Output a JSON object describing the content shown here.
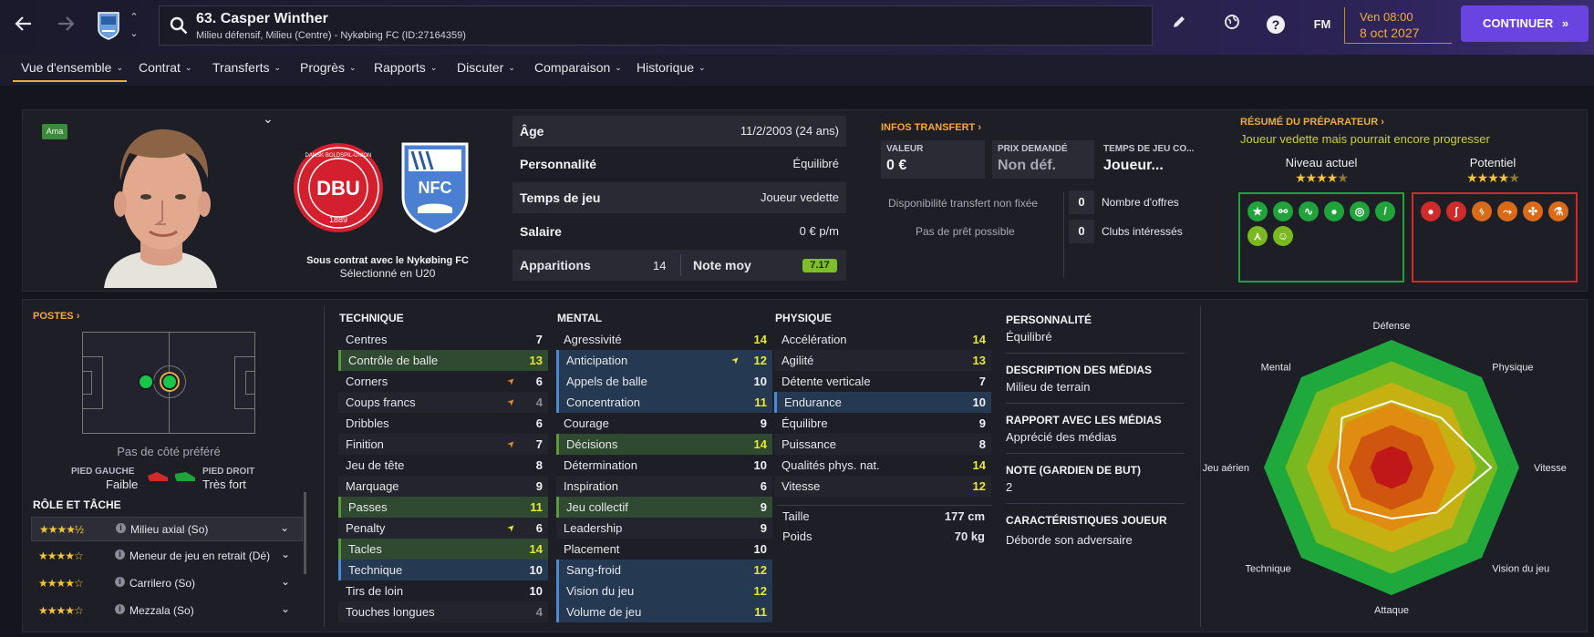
{
  "header": {
    "player_title": "63. Casper Winther",
    "player_subtitle": "Milieu défensif, Milieu (Centre) - Nykøbing FC (ID:27164359)",
    "fm_label": "FM",
    "date_line1": "Ven 08:00",
    "date_line2": "8 oct 2027",
    "continue_label": "CONTINUER",
    "icons": [
      "back-arrow-icon",
      "forward-arrow-icon",
      "club-badge-icon",
      "up-down-chevron-icon",
      "search-icon",
      "pencil-icon",
      "globe-icon",
      "help-icon",
      "continue-chevron-icon"
    ]
  },
  "tabs": [
    {
      "label": "Vue d'ensemble",
      "active": true
    },
    {
      "label": "Contrat"
    },
    {
      "label": "Transferts"
    },
    {
      "label": "Progrès"
    },
    {
      "label": "Rapports"
    },
    {
      "label": "Discuter"
    },
    {
      "label": "Comparaison"
    },
    {
      "label": "Historique"
    }
  ],
  "profile": {
    "ama_badge": "Ama",
    "dbu_text_top": "DANSK BOLDSPIL-UNION",
    "dbu_letters": "DBU",
    "dbu_year": "1889",
    "nfc_letters": "NFC",
    "contract_line": "Sous contrat avec le Nykøbing FC",
    "selection_line": "Sélectionné en U20"
  },
  "info": {
    "rows": [
      {
        "k": "Âge",
        "v": "11/2/2003 (24 ans)"
      },
      {
        "k": "Personnalité",
        "v": "Équilibré"
      },
      {
        "k": "Temps de jeu",
        "v": "Joueur vedette"
      },
      {
        "k": "Salaire",
        "v": "0 € p/m"
      }
    ],
    "appearances_label": "Apparitions",
    "appearances_value": "14",
    "rating_label": "Note moy",
    "rating_value": "7.17"
  },
  "transfer": {
    "title": "INFOS TRANSFERT",
    "value_label": "VALEUR",
    "value": "0 €",
    "asking_label": "PRIX DEMANDÉ",
    "asking_value": "Non déf.",
    "playtime_label": "TEMPS DE JEU CO...",
    "playtime_value": "Joueur...",
    "availability": "Disponibilité transfert non fixée",
    "loan": "Pas de prêt possible",
    "offers_count": "0",
    "offers_label": "Nombre d'offres",
    "clubs_count": "0",
    "clubs_label": "Clubs intéressés"
  },
  "coach_report": {
    "title": "RÉSUMÉ DU PRÉPARATEUR",
    "summary": "Joueur vedette mais pourrait encore progresser",
    "current_label": "Niveau actuel",
    "current_stars": 4.5,
    "potential_label": "Potentiel",
    "potential_stars": 4.5,
    "strengths_icons": [
      "star-icon",
      "boots-icon",
      "wave-icon",
      "brain-icon",
      "target-icon",
      "bandage-icon",
      "run-icon",
      "smile-icon"
    ],
    "weaknesses_icons": [
      "ball-icon",
      "ankle-icon",
      "kick-icon",
      "tackle-icon",
      "lungs-icon",
      "flask-icon"
    ],
    "strength_color": "#1fa33a",
    "weakness_color": "#d12a2a"
  },
  "positions": {
    "title": "POSTES",
    "no_side": "Pas de côté préféré",
    "left_foot_label": "PIED GAUCHE",
    "left_foot_value": "Faible",
    "right_foot_label": "PIED DROIT",
    "right_foot_value": "Très fort",
    "roles_title": "RÔLE ET TÂCHE",
    "roles": [
      {
        "stars": "★★★★½",
        "name": "Milieu axial (So)"
      },
      {
        "stars": "★★★★☆",
        "name": "Meneur de jeu en retrait (Dé)"
      },
      {
        "stars": "★★★★☆",
        "name": "Carrilero (So)"
      },
      {
        "stars": "★★★★☆",
        "name": "Mezzala (So)"
      }
    ]
  },
  "attributes": {
    "technique_title": "TECHNIQUE",
    "mental_title": "MENTAL",
    "physical_title": "PHYSIQUE",
    "technique": [
      {
        "n": "Centres",
        "v": "7"
      },
      {
        "n": "Contrôle de balle",
        "v": "13",
        "hl": "g"
      },
      {
        "n": "Corners",
        "v": "6",
        "t": "o"
      },
      {
        "n": "Coups francs",
        "v": "4",
        "t": "o"
      },
      {
        "n": "Dribbles",
        "v": "6"
      },
      {
        "n": "Finition",
        "v": "7",
        "t": "o"
      },
      {
        "n": "Jeu de tête",
        "v": "8"
      },
      {
        "n": "Marquage",
        "v": "9"
      },
      {
        "n": "Passes",
        "v": "11",
        "hl": "g"
      },
      {
        "n": "Penalty",
        "v": "6",
        "t": "y"
      },
      {
        "n": "Tacles",
        "v": "14",
        "hl": "g"
      },
      {
        "n": "Technique",
        "v": "10",
        "hl": "b"
      },
      {
        "n": "Tirs de loin",
        "v": "10"
      },
      {
        "n": "Touches longues",
        "v": "4"
      }
    ],
    "mental": [
      {
        "n": "Agressivité",
        "v": "14"
      },
      {
        "n": "Anticipation",
        "v": "12",
        "hl": "b",
        "t": "y"
      },
      {
        "n": "Appels de balle",
        "v": "10",
        "hl": "b"
      },
      {
        "n": "Concentration",
        "v": "11",
        "hl": "b"
      },
      {
        "n": "Courage",
        "v": "9"
      },
      {
        "n": "Décisions",
        "v": "14",
        "hl": "g"
      },
      {
        "n": "Détermination",
        "v": "10"
      },
      {
        "n": "Inspiration",
        "v": "6"
      },
      {
        "n": "Jeu collectif",
        "v": "9",
        "hl": "g"
      },
      {
        "n": "Leadership",
        "v": "9"
      },
      {
        "n": "Placement",
        "v": "10"
      },
      {
        "n": "Sang-froid",
        "v": "12",
        "hl": "b"
      },
      {
        "n": "Vision du jeu",
        "v": "12",
        "hl": "b"
      },
      {
        "n": "Volume de jeu",
        "v": "11",
        "hl": "b"
      }
    ],
    "physical": [
      {
        "n": "Accélération",
        "v": "14"
      },
      {
        "n": "Agilité",
        "v": "13"
      },
      {
        "n": "Détente verticale",
        "v": "7"
      },
      {
        "n": "Endurance",
        "v": "10",
        "hl": "b"
      },
      {
        "n": "Équilibre",
        "v": "9"
      },
      {
        "n": "Puissance",
        "v": "8"
      },
      {
        "n": "Qualités phys. nat.",
        "v": "14"
      },
      {
        "n": "Vitesse",
        "v": "12"
      }
    ],
    "height_label": "Taille",
    "height_value": "177 cm",
    "weight_label": "Poids",
    "weight_value": "70 kg"
  },
  "details": [
    {
      "k": "PERSONNALITÉ",
      "v": "Équilibré"
    },
    {
      "k": "DESCRIPTION DES MÉDIAS",
      "v": "Milieu de terrain"
    },
    {
      "k": "RAPPORT AVEC LES MÉDIAS",
      "v": "Apprécié des médias"
    },
    {
      "k": "NOTE (GARDIEN DE BUT)",
      "v": "2"
    },
    {
      "k": "CARACTÉRISTIQUES JOUEUR",
      "v": "Déborde son adversaire"
    }
  ],
  "radar": {
    "labels": [
      "Défense",
      "Physique",
      "Vitesse",
      "Vision du jeu",
      "Attaque",
      "Technique",
      "Jeu aérien",
      "Mental"
    ],
    "values": [
      0.52,
      0.55,
      0.78,
      0.5,
      0.4,
      0.45,
      0.42,
      0.55
    ],
    "ring_colors": [
      "#1fa83c",
      "#7ab81f",
      "#c7b012",
      "#e08c10",
      "#d0560f",
      "#c01818"
    ]
  }
}
